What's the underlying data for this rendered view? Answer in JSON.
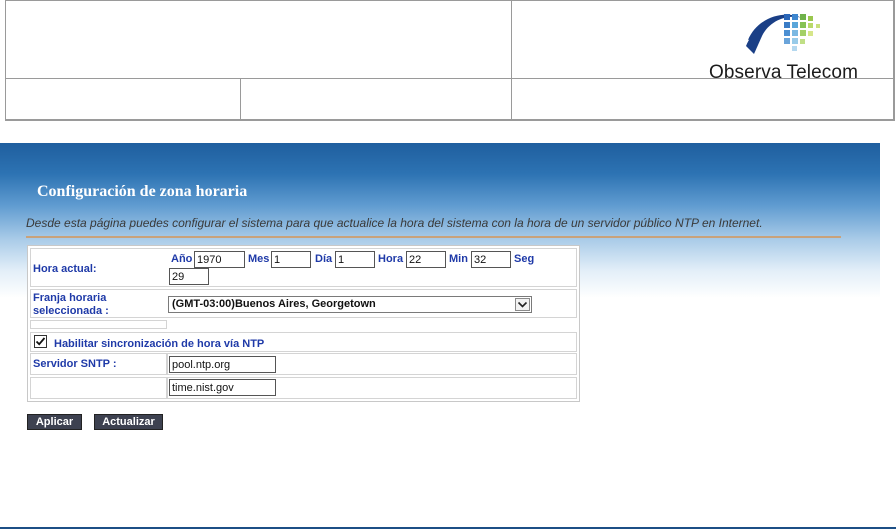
{
  "header": {
    "logo_text": "Observa Telecom"
  },
  "page": {
    "title": "Configuración de zona horaria",
    "intro": "Desde esta página puedes configurar el sistema para que actualice la hora del sistema con la hora de un servidor público NTP en Internet."
  },
  "form": {
    "current_time_label": "Hora actual:",
    "year_label": "Año",
    "year_value": "1970",
    "month_label": "Mes",
    "month_value": "1",
    "day_label": "Día",
    "day_value": "1",
    "hour_label": "Hora",
    "hour_value": "22",
    "min_label": "Min",
    "min_value": "32",
    "sec_label": "Seg",
    "sec_value": "29",
    "timezone_label_1": "Franja horaria",
    "timezone_label_2": "seleccionada :",
    "timezone_value": "(GMT-03:00)Buenos Aires, Georgetown",
    "ntp_enable_label": "Habilitar sincronización de hora vía NTP",
    "ntp_enabled": true,
    "sntp_label": "Servidor SNTP :",
    "sntp_server_1": "pool.ntp.org",
    "sntp_server_2": "time.nist.gov"
  },
  "buttons": {
    "apply": "Aplicar",
    "refresh": "Actualizar"
  },
  "colors": {
    "label_blue": "#1f3aa8",
    "banner_blue": "#2d73b3",
    "button_dark": "#3d4150"
  }
}
